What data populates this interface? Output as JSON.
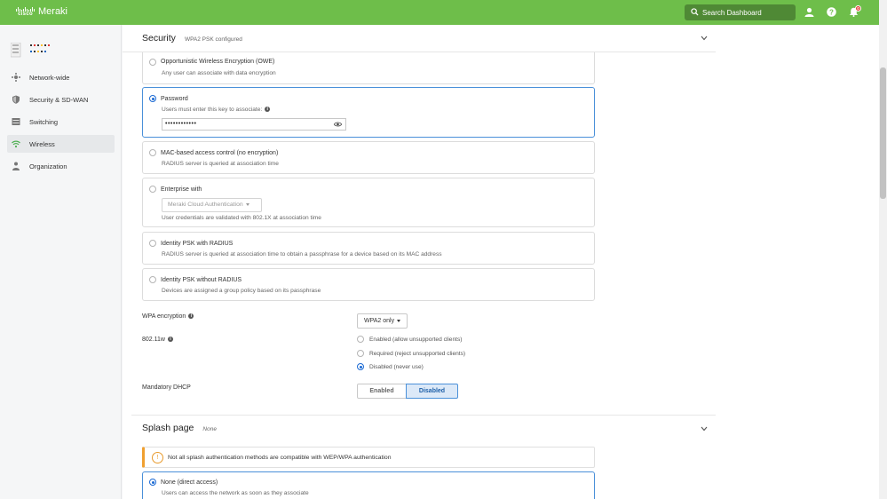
{
  "app": {
    "brand_small": "cisco",
    "brand": "Meraki",
    "search_placeholder": "Search Dashboard",
    "notification_count": "0"
  },
  "colors": {
    "header_green": "#6ebe4a",
    "accent_blue": "#1d6bd4",
    "warning_orange": "#f0a030"
  },
  "sidebar": {
    "items": [
      {
        "label": "Network-wide",
        "icon": "network-icon"
      },
      {
        "label": "Security & SD-WAN",
        "icon": "shield-icon"
      },
      {
        "label": "Switching",
        "icon": "switch-icon"
      },
      {
        "label": "Wireless",
        "icon": "wifi-icon",
        "active": true
      },
      {
        "label": "Organization",
        "icon": "organization-icon"
      }
    ]
  },
  "security": {
    "title": "Security",
    "subtitle": "WPA2 PSK configured",
    "options": [
      {
        "title": "Opportunistic Wireless Encryption (OWE)",
        "desc": "Any user can associate with data encryption",
        "selected": false
      },
      {
        "title": "Password",
        "desc": "Users must enter this key to associate:",
        "selected": true,
        "password_value": "••••••••••••"
      },
      {
        "title": "MAC-based access control (no encryption)",
        "desc": "RADIUS server is queried at association time",
        "selected": false
      },
      {
        "title": "Enterprise with",
        "dropdown": "Meraki Cloud Authentication",
        "desc": "User credentials are validated with 802.1X at association time",
        "selected": false
      },
      {
        "title": "Identity PSK with RADIUS",
        "desc": "RADIUS server is queried at association time to obtain a passphrase for a device based on its MAC address",
        "selected": false
      },
      {
        "title": "Identity PSK without RADIUS",
        "desc": "Devices are assigned a group policy based on its passphrase",
        "selected": false
      }
    ],
    "wpa_encryption": {
      "label": "WPA encryption",
      "value": "WPA2 only"
    },
    "w80211": {
      "label": "802.11w",
      "options": [
        {
          "label": "Enabled (allow unsupported clients)",
          "selected": false
        },
        {
          "label": "Required (reject unsupported clients)",
          "selected": false
        },
        {
          "label": "Disabled (never use)",
          "selected": true
        }
      ]
    },
    "mandatory_dhcp": {
      "label": "Mandatory DHCP",
      "enabled": "Enabled",
      "disabled": "Disabled",
      "selected": "Disabled"
    }
  },
  "splash": {
    "title": "Splash page",
    "subtitle": "None",
    "warning": "Not all splash authentication methods are compatible with WEP/WPA authentication",
    "options": [
      {
        "title": "None (direct access)",
        "desc": "Users can access the network as soon as they associate",
        "selected": true
      }
    ]
  }
}
